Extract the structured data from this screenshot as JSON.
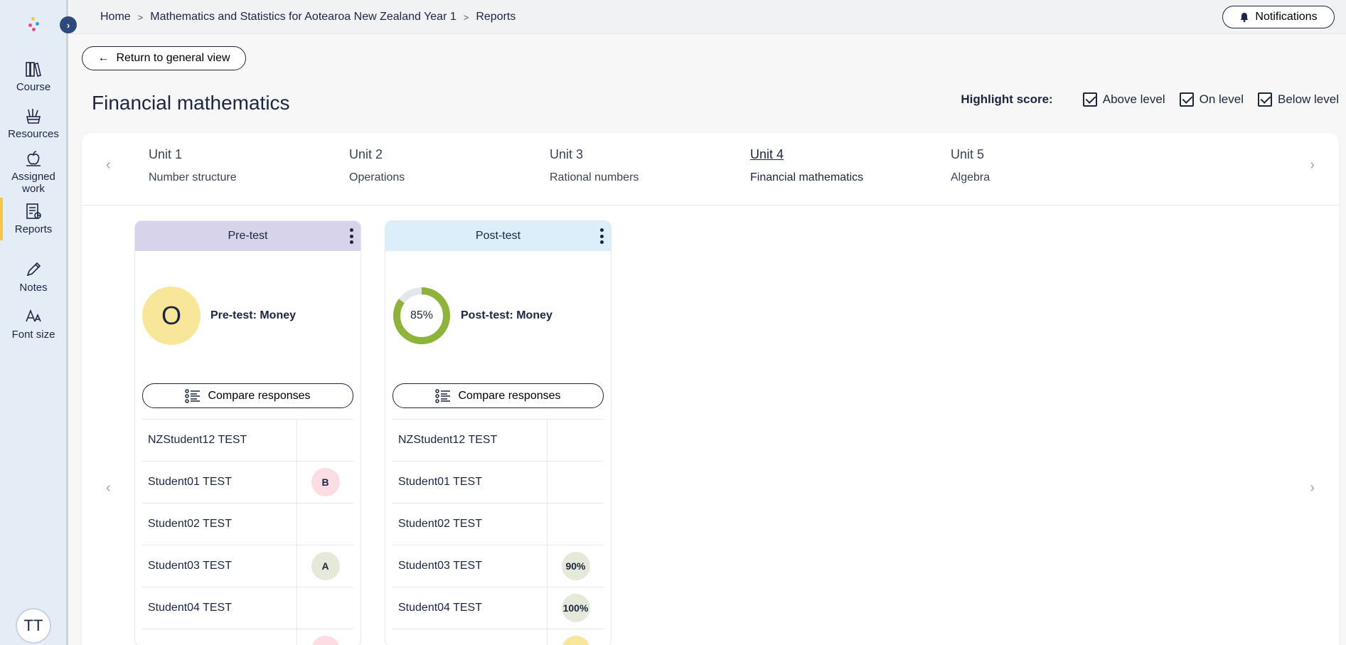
{
  "sidebar": {
    "items": [
      {
        "label": "Course",
        "icon": "books-icon"
      },
      {
        "label": "Resources",
        "icon": "resources-icon"
      },
      {
        "label": "Assigned work",
        "icon": "apple-icon"
      },
      {
        "label": "Reports",
        "icon": "reports-icon"
      },
      {
        "label": "Notes",
        "icon": "pencil-icon"
      },
      {
        "label": "Font size",
        "icon": "font-size-icon"
      }
    ],
    "avatar": "TT"
  },
  "breadcrumb": [
    "Home",
    "Mathematics and Statistics for Aotearoa New Zealand Year 1",
    "Reports"
  ],
  "header": {
    "notifications_label": "Notifications"
  },
  "return_label": "Return to general view",
  "page_title": "Financial mathematics",
  "highlight": {
    "label": "Highlight score:",
    "options": [
      "Above level",
      "On level",
      "Below level"
    ]
  },
  "units": [
    {
      "title": "Unit 1",
      "subtitle": "Number structure"
    },
    {
      "title": "Unit 2",
      "subtitle": "Operations"
    },
    {
      "title": "Unit 3",
      "subtitle": "Rational numbers"
    },
    {
      "title": "Unit 4",
      "subtitle": "Financial mathematics",
      "active": true
    },
    {
      "title": "Unit 5",
      "subtitle": "Algebra"
    }
  ],
  "tests": [
    {
      "header": "Pre-test",
      "header_color": "#d6d3ea",
      "score": "O",
      "score_label": "Pre-test: Money",
      "compare_label": "Compare responses",
      "students": [
        {
          "name": "NZStudent12 TEST",
          "result": ""
        },
        {
          "name": "Student01 TEST",
          "result": "B",
          "color": "#fbdde3"
        },
        {
          "name": "Student02 TEST",
          "result": ""
        },
        {
          "name": "Student03 TEST",
          "result": "A",
          "color": "#e5e9d9"
        },
        {
          "name": "Student04 TEST",
          "result": ""
        }
      ]
    },
    {
      "header": "Post-test",
      "header_color": "#dbeef9",
      "score": "85%",
      "score_value": 85,
      "score_label": "Post-test: Money",
      "compare_label": "Compare responses",
      "students": [
        {
          "name": "NZStudent12 TEST",
          "result": ""
        },
        {
          "name": "Student01 TEST",
          "result": ""
        },
        {
          "name": "Student02 TEST",
          "result": ""
        },
        {
          "name": "Student03 TEST",
          "result": "90%",
          "color": "#e5e9d9"
        },
        {
          "name": "Student04 TEST",
          "result": "100%",
          "color": "#e5e9d9"
        }
      ]
    }
  ],
  "colors": {
    "accent": "#f6c544",
    "donut": "#8db33a",
    "donut_track": "#e3e6ea"
  }
}
